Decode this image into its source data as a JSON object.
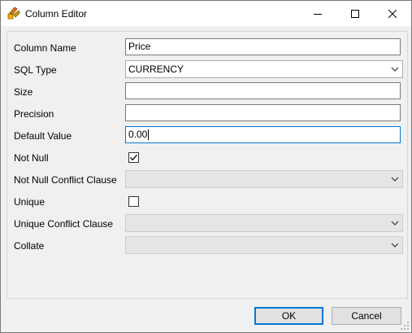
{
  "window": {
    "title": "Column Editor"
  },
  "icons": {
    "app": "column-editor-app-icon",
    "minimize": "minimize-icon",
    "maximize": "maximize-icon",
    "close": "close-icon",
    "dropdown": "chevron-down-icon",
    "check": "checkmark-icon"
  },
  "colors": {
    "focus": "#0078d7",
    "panel_bg": "#f0f0f0",
    "disabled_bg": "#e5e5e5"
  },
  "form": {
    "column_name": {
      "label": "Column Name",
      "value": "Price"
    },
    "sql_type": {
      "label": "SQL Type",
      "value": "CURRENCY"
    },
    "size": {
      "label": "Size",
      "value": ""
    },
    "precision": {
      "label": "Precision",
      "value": ""
    },
    "default_value": {
      "label": "Default Value",
      "value": "0.00"
    },
    "not_null": {
      "label": "Not Null",
      "checked": true
    },
    "not_null_conflict": {
      "label": "Not Null Conflict Clause",
      "value": ""
    },
    "unique": {
      "label": "Unique",
      "checked": false
    },
    "unique_conflict": {
      "label": "Unique Conflict Clause",
      "value": ""
    },
    "collate": {
      "label": "Collate",
      "value": ""
    }
  },
  "buttons": {
    "ok": "OK",
    "cancel": "Cancel"
  }
}
